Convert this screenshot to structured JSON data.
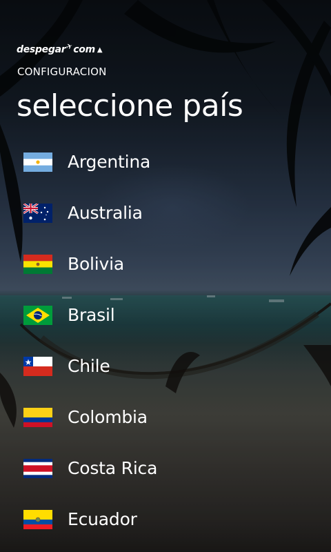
{
  "app": {
    "logo_text": "despegar",
    "logo_suffix": "com",
    "section_title": "CONFIGURACION",
    "page_title": "seleccione país"
  },
  "countries": [
    {
      "label": "Argentina",
      "flag_icon": "argentina-flag-icon"
    },
    {
      "label": "Australia",
      "flag_icon": "australia-flag-icon"
    },
    {
      "label": "Bolivia",
      "flag_icon": "bolivia-flag-icon"
    },
    {
      "label": "Brasil",
      "flag_icon": "brasil-flag-icon"
    },
    {
      "label": "Chile",
      "flag_icon": "chile-flag-icon"
    },
    {
      "label": "Colombia",
      "flag_icon": "colombia-flag-icon"
    },
    {
      "label": "Costa Rica",
      "flag_icon": "costa-rica-flag-icon"
    },
    {
      "label": "Ecuador",
      "flag_icon": "ecuador-flag-icon"
    }
  ],
  "colors": {
    "text": "#ffffff",
    "background": "#0e1620"
  }
}
